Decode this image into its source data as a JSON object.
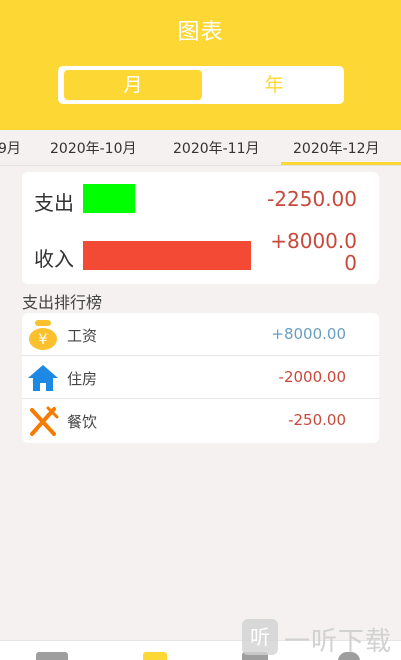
{
  "header": {
    "title": "图表"
  },
  "period_toggle": {
    "month": "月",
    "year": "年"
  },
  "months": [
    "9月",
    "2020年-10月",
    "2020年-11月",
    "2020年-12月"
  ],
  "summary": {
    "expense_label": "支出",
    "expense_amount": "-2250.00",
    "income_label": "收入",
    "income_amount_line1": "+8000.0",
    "income_amount_line2": "0",
    "expense_bar_color": "#00ff00",
    "income_bar_color": "#f24a35"
  },
  "ranking": {
    "title": "支出排行榜",
    "items": [
      {
        "name": "工资",
        "amount": "+8000.00",
        "icon": "money-bag-icon",
        "amount_color": "#6a9ec0"
      },
      {
        "name": "住房",
        "amount": "-2000.00",
        "icon": "house-icon",
        "amount_color": "#c8493b"
      },
      {
        "name": "餐饮",
        "amount": "-250.00",
        "icon": "fork-knife-icon",
        "amount_color": "#c8493b"
      }
    ]
  },
  "watermark": {
    "badge": "听",
    "text": "一听下载"
  },
  "colors": {
    "accent": "#fdd835",
    "background": "#f4f1f0"
  }
}
